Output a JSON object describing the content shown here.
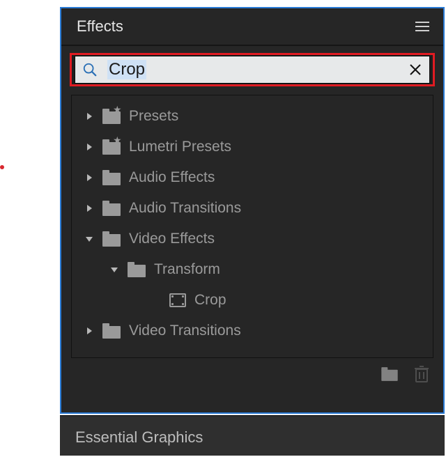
{
  "panel": {
    "title": "Effects",
    "search": {
      "value": "Crop"
    }
  },
  "tree": [
    {
      "label": "Presets",
      "icon": "folder-star",
      "depth": 1,
      "expanded": false,
      "type": "folder"
    },
    {
      "label": "Lumetri Presets",
      "icon": "folder-star",
      "depth": 1,
      "expanded": false,
      "type": "folder"
    },
    {
      "label": "Audio Effects",
      "icon": "folder",
      "depth": 1,
      "expanded": false,
      "type": "folder"
    },
    {
      "label": "Audio Transitions",
      "icon": "folder",
      "depth": 1,
      "expanded": false,
      "type": "folder"
    },
    {
      "label": "Video Effects",
      "icon": "folder",
      "depth": 1,
      "expanded": true,
      "type": "folder"
    },
    {
      "label": "Transform",
      "icon": "folder",
      "depth": 2,
      "expanded": true,
      "type": "folder"
    },
    {
      "label": "Crop",
      "icon": "effect",
      "depth": 3,
      "expanded": null,
      "type": "effect"
    },
    {
      "label": "Video Transitions",
      "icon": "folder",
      "depth": 1,
      "expanded": false,
      "type": "folder"
    }
  ],
  "secondary_panel": {
    "title": "Essential Graphics"
  }
}
